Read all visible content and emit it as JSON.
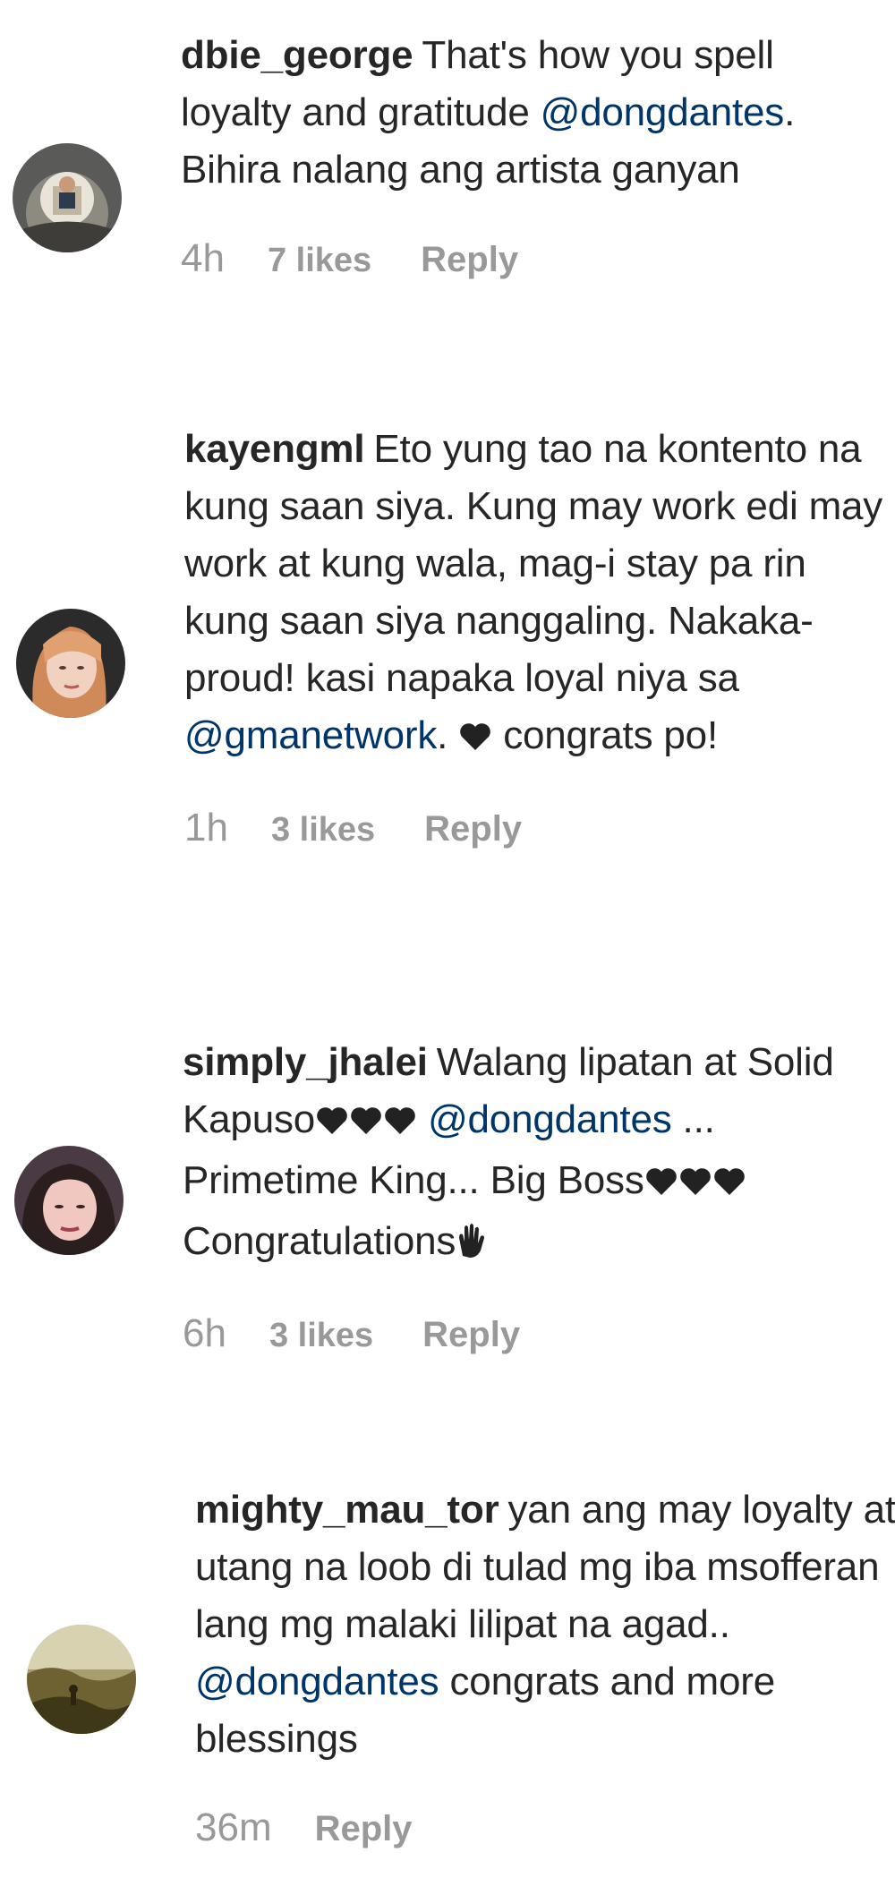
{
  "comments": [
    {
      "username": "dbie_george",
      "segments": [
        {
          "type": "text",
          "value": "That's how you spell loyalty and gratitude "
        },
        {
          "type": "mention",
          "value": "@dongdantes"
        },
        {
          "type": "text",
          "value": ". Bihira nalang ang artista ganyan"
        }
      ],
      "time": "4h",
      "likes": "7 likes",
      "reply": "Reply"
    },
    {
      "username": "kayengml",
      "segments": [
        {
          "type": "text",
          "value": "Eto yung tao na kontento na kung saan siya. Kung may work edi may work at kung wala, mag-i stay pa rin kung saan siya nanggaling. Nakaka-proud! kasi napaka loyal niya sa "
        },
        {
          "type": "mention",
          "value": "@gmanetwork"
        },
        {
          "type": "text",
          "value": ". "
        },
        {
          "type": "emoji",
          "value": "black-heart"
        },
        {
          "type": "text",
          "value": " congrats po!"
        }
      ],
      "time": "1h",
      "likes": "3 likes",
      "reply": "Reply"
    },
    {
      "username": "simply_jhalei",
      "segments": [
        {
          "type": "text",
          "value": "Walang lipatan at Solid Kapuso"
        },
        {
          "type": "emoji",
          "value": "black-heart"
        },
        {
          "type": "emoji",
          "value": "black-heart"
        },
        {
          "type": "emoji",
          "value": "black-heart"
        },
        {
          "type": "text",
          "value": " "
        },
        {
          "type": "mention",
          "value": "@dongdantes"
        },
        {
          "type": "text",
          "value": " ... Primetime King... Big Boss"
        },
        {
          "type": "emoji",
          "value": "black-heart"
        },
        {
          "type": "emoji",
          "value": "black-heart"
        },
        {
          "type": "emoji",
          "value": "black-heart"
        },
        {
          "type": "text",
          "value": " Congratulations"
        },
        {
          "type": "emoji",
          "value": "raised-hands"
        }
      ],
      "time": "6h",
      "likes": "3 likes",
      "reply": "Reply"
    },
    {
      "username": "mighty_mau_tor",
      "segments": [
        {
          "type": "text",
          "value": "yan ang may loyalty at utang na loob di tulad mg iba msofferan lang mg malaki lilipat na agad.. "
        },
        {
          "type": "mention",
          "value": "@dongdantes"
        },
        {
          "type": "text",
          "value": " congrats and more blessings"
        }
      ],
      "time": "36m",
      "likes": "",
      "reply": "Reply"
    }
  ],
  "colors": {
    "mention": "#003569",
    "meta": "#999999",
    "text": "#262626"
  }
}
